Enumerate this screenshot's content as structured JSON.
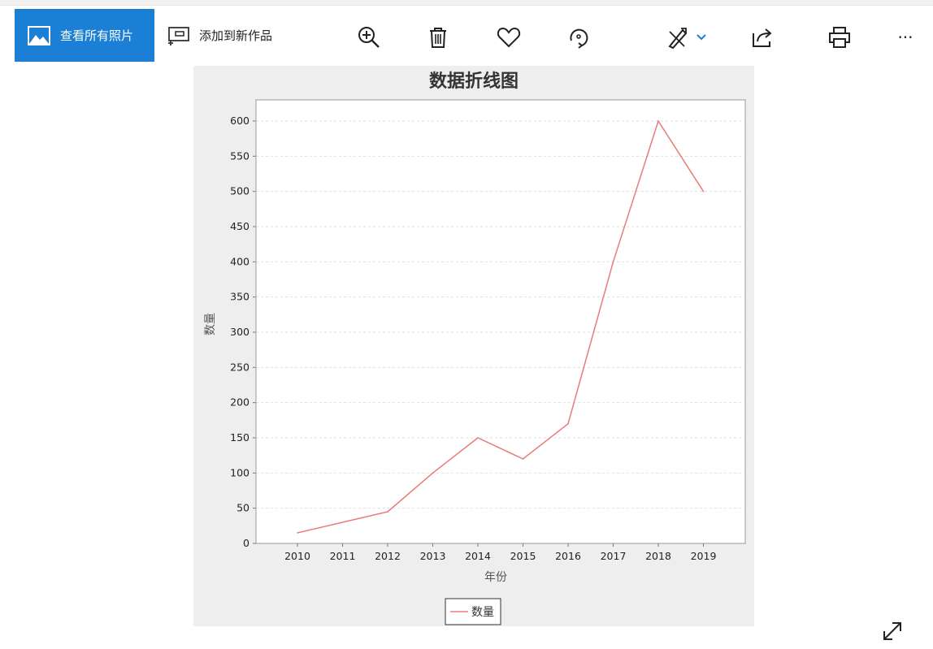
{
  "toolbar": {
    "view_all_label": "查看所有照片",
    "add_to_creation_label": "添加到新作品",
    "icons": [
      "zoom-in-icon",
      "delete-icon",
      "favorite-icon",
      "rotate-icon",
      "edit-icon",
      "share-icon",
      "print-icon",
      "more-icon"
    ],
    "more_glyph": "···",
    "accent_color": "#1b7fd6"
  },
  "chart_data": {
    "type": "line",
    "title": "数据折线图",
    "xlabel": "年份",
    "ylabel": "数量",
    "categories": [
      "2010",
      "2011",
      "2012",
      "2013",
      "2014",
      "2015",
      "2016",
      "2017",
      "2018",
      "2019"
    ],
    "series": [
      {
        "name": "数量",
        "values": [
          15,
          30,
          45,
          100,
          150,
          120,
          170,
          400,
          600,
          500
        ],
        "color": "#e97b7b"
      }
    ],
    "ylim": [
      0,
      630
    ],
    "yticks": [
      0,
      50,
      100,
      150,
      200,
      250,
      300,
      350,
      400,
      450,
      500,
      550,
      600
    ],
    "grid": true,
    "legend_position": "bottom"
  }
}
